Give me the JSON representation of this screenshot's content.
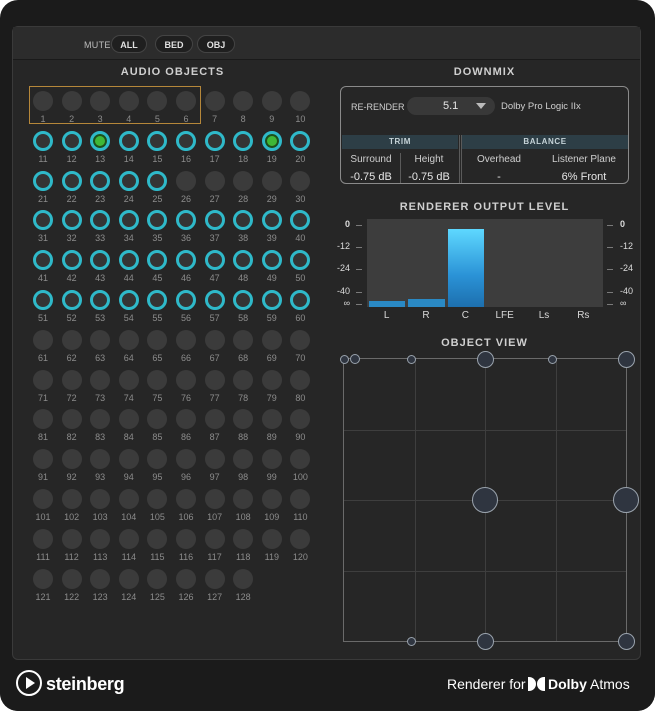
{
  "mute": {
    "label": "MUTE",
    "buttons": [
      "ALL",
      "BED",
      "OBJ"
    ]
  },
  "audio_objects": {
    "title": "AUDIO OBJECTS",
    "count": 128,
    "bed_objects": [
      1,
      2,
      3,
      4,
      5,
      6
    ],
    "active_objects": [
      11,
      12,
      13,
      14,
      15,
      16,
      17,
      18,
      19,
      20,
      21,
      22,
      23,
      24,
      25,
      31,
      32,
      33,
      34,
      35,
      36,
      37,
      38,
      39,
      40,
      41,
      42,
      43,
      44,
      45,
      46,
      47,
      48,
      49,
      50,
      51,
      52,
      53,
      54,
      55,
      56,
      57,
      58,
      59,
      60
    ],
    "green_objects": [
      13,
      19
    ]
  },
  "downmix": {
    "title": "DOWNMIX",
    "rerender_label": "RE-RENDER",
    "rerender_value": "5.1",
    "mode": "Dolby Pro Logic IIx",
    "trim": {
      "label": "TRIM",
      "columns": [
        {
          "head": "Surround",
          "value": "-0.75 dB"
        },
        {
          "head": "Height",
          "value": "-0.75 dB"
        }
      ]
    },
    "balance": {
      "label": "BALANCE",
      "columns": [
        {
          "head": "Overhead",
          "value": "-"
        },
        {
          "head": "Listener Plane",
          "value": "6% Front"
        }
      ]
    }
  },
  "renderer_output": {
    "title": "RENDERER OUTPUT LEVEL",
    "scale_labels": [
      "0",
      "-12",
      "-24",
      "-40",
      "∞"
    ],
    "channels": [
      "L",
      "R",
      "C",
      "LFE",
      "Ls",
      "Rs"
    ],
    "levels": [
      0.08,
      0.1,
      0.98,
      0,
      0,
      0
    ]
  },
  "object_view": {
    "title": "OBJECT VIEW"
  },
  "footer": {
    "brand": "steinberg",
    "renderer_for": "Renderer for",
    "dolby_brand": "Dolby",
    "dolby_product": "Atmos"
  },
  "colors": {
    "active_ring": "#2fb9c9",
    "green_fill": "#3fb836",
    "meter_hot": "#5ed8ff",
    "bed_frame": "#b5873a"
  }
}
